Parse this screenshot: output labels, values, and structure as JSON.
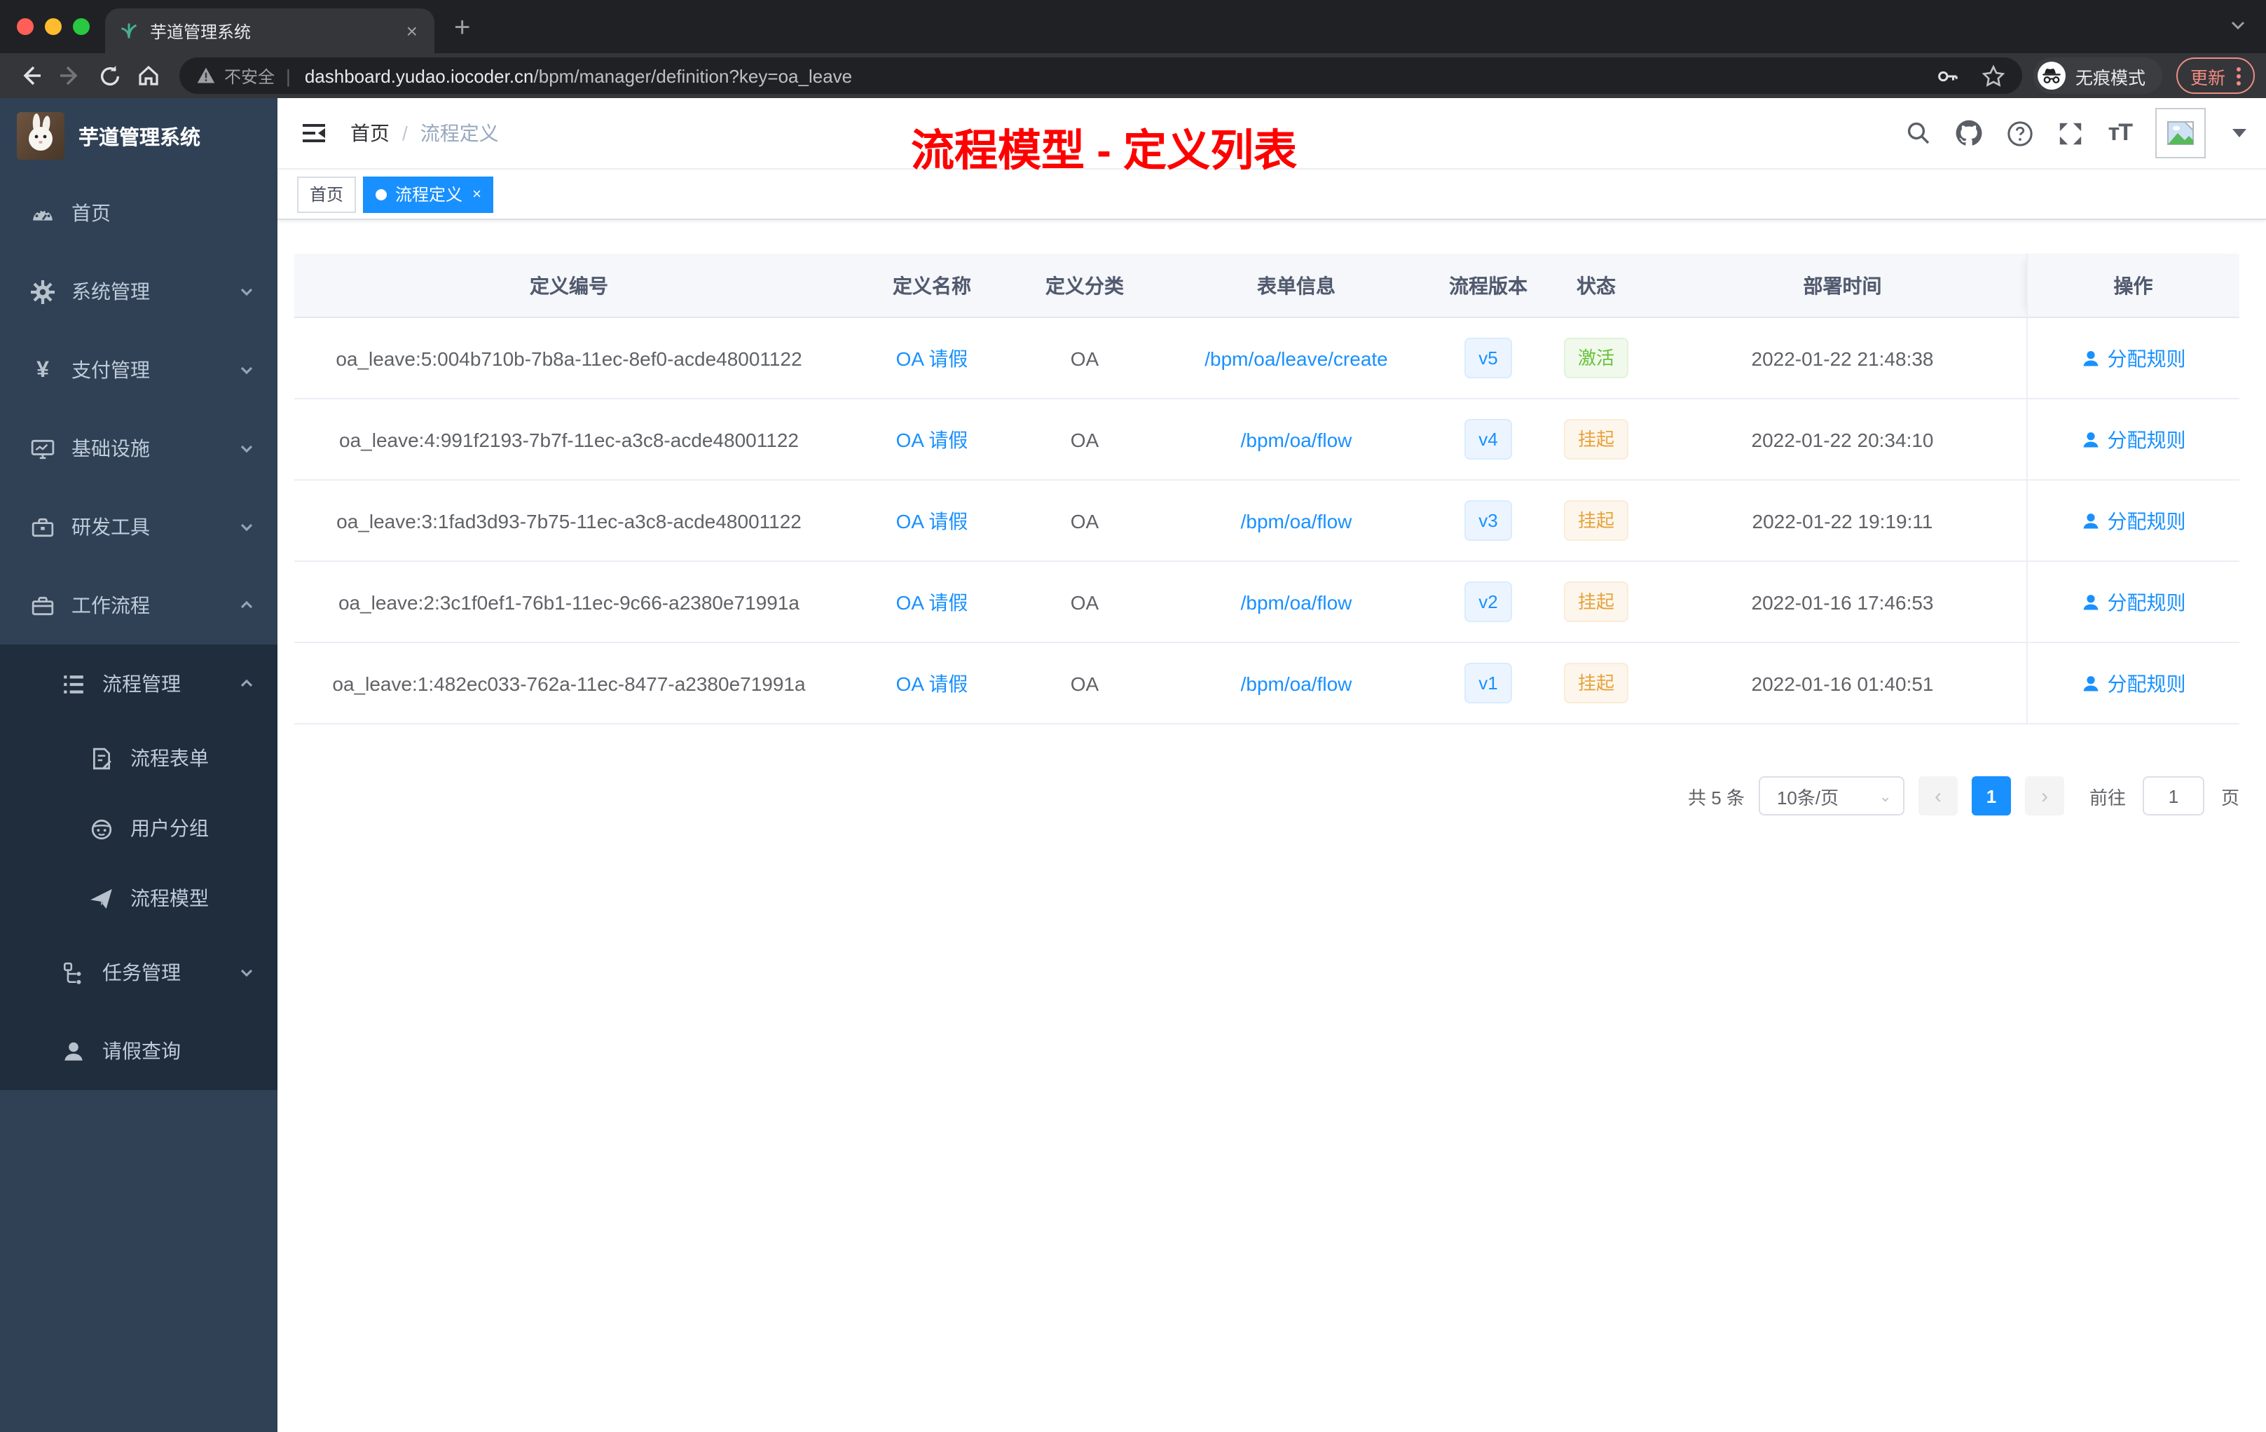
{
  "browser": {
    "tab": {
      "title": "芋道管理系统",
      "close_glyph": "×",
      "new_tab_glyph": "+"
    },
    "address": {
      "security_label": "不安全",
      "separator": "|",
      "domain": "dashboard.yudao.iocoder.cn",
      "path": "/bpm/manager/definition?key=oa_leave"
    },
    "incognito_label": "无痕模式",
    "update_label": "更新"
  },
  "sidebar": {
    "logo_title": "芋道管理系统",
    "items": [
      {
        "label": "首页",
        "icon": "dashboard-icon"
      },
      {
        "label": "系统管理",
        "icon": "gear-icon",
        "expand": "down"
      },
      {
        "label": "支付管理",
        "icon": "yen-icon",
        "expand": "down"
      },
      {
        "label": "基础设施",
        "icon": "monitor-icon",
        "expand": "down"
      },
      {
        "label": "研发工具",
        "icon": "toolbox-icon",
        "expand": "down"
      },
      {
        "label": "工作流程",
        "icon": "briefcase-icon",
        "expand": "up"
      },
      {
        "label": "流程管理",
        "icon": "list-icon",
        "expand": "up"
      },
      {
        "label": "流程表单",
        "icon": "form-icon"
      },
      {
        "label": "用户分组",
        "icon": "robot-icon"
      },
      {
        "label": "流程模型",
        "icon": "paper-plane-icon"
      },
      {
        "label": "任务管理",
        "icon": "tree-icon",
        "expand": "down"
      },
      {
        "label": "请假查询",
        "icon": "user-icon"
      }
    ]
  },
  "navbar": {
    "breadcrumb": {
      "home": "首页",
      "separator": "/",
      "current": "流程定义"
    },
    "icons": [
      "search-icon",
      "github-icon",
      "help-icon",
      "fullscreen-icon",
      "font-size-icon",
      "avatar",
      "caret-down"
    ]
  },
  "annotation": {
    "text": "流程模型 - 定义列表",
    "color": "#ff0000"
  },
  "tags": {
    "home": "首页",
    "active": "流程定义",
    "close_glyph": "×"
  },
  "table": {
    "columns": [
      "定义编号",
      "定义名称",
      "定义分类",
      "表单信息",
      "流程版本",
      "状态",
      "部署时间",
      "操作"
    ],
    "rows": [
      {
        "id": "oa_leave:5:004b710b-7b8a-11ec-8ef0-acde48001122",
        "name": "OA 请假",
        "category": "OA",
        "form": "/bpm/oa/leave/create",
        "version": "v5",
        "status": "激活",
        "status_type": "active",
        "time": "2022-01-22 21:48:38",
        "action": "分配规则"
      },
      {
        "id": "oa_leave:4:991f2193-7b7f-11ec-a3c8-acde48001122",
        "name": "OA 请假",
        "category": "OA",
        "form": "/bpm/oa/flow",
        "version": "v4",
        "status": "挂起",
        "status_type": "suspended",
        "time": "2022-01-22 20:34:10",
        "action": "分配规则"
      },
      {
        "id": "oa_leave:3:1fad3d93-7b75-11ec-a3c8-acde48001122",
        "name": "OA 请假",
        "category": "OA",
        "form": "/bpm/oa/flow",
        "version": "v3",
        "status": "挂起",
        "status_type": "suspended",
        "time": "2022-01-22 19:19:11",
        "action": "分配规则"
      },
      {
        "id": "oa_leave:2:3c1f0ef1-76b1-11ec-9c66-a2380e71991a",
        "name": "OA 请假",
        "category": "OA",
        "form": "/bpm/oa/flow",
        "version": "v2",
        "status": "挂起",
        "status_type": "suspended",
        "time": "2022-01-16 17:46:53",
        "action": "分配规则"
      },
      {
        "id": "oa_leave:1:482ec033-762a-11ec-8477-a2380e71991a",
        "name": "OA 请假",
        "category": "OA",
        "form": "/bpm/oa/flow",
        "version": "v1",
        "status": "挂起",
        "status_type": "suspended",
        "time": "2022-01-16 01:40:51",
        "action": "分配规则"
      }
    ]
  },
  "pagination": {
    "total": "共 5 条",
    "page_size": "10条/页",
    "prev_glyph": "‹",
    "current_page": "1",
    "next_glyph": "›",
    "goto_prefix": "前往",
    "goto_value": "1",
    "goto_suffix": "页"
  },
  "colors": {
    "accent": "#1890ff",
    "success": "#67c23a",
    "warning": "#e6a23c",
    "sidebar": "#304156",
    "sidebar_sub": "#1f2d3d",
    "annotation": "#ff0000"
  }
}
